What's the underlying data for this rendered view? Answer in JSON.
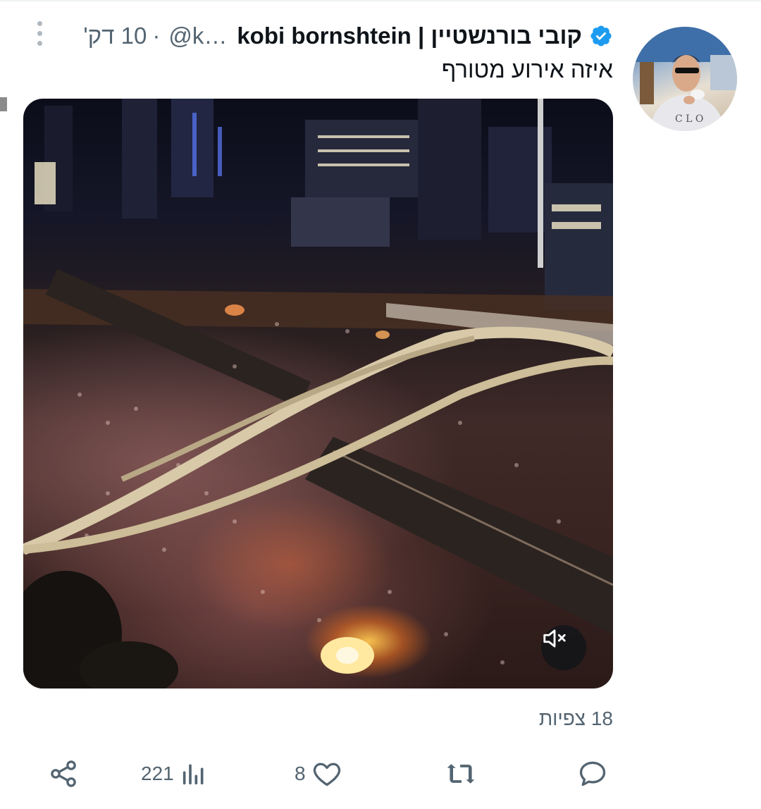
{
  "post": {
    "display_name": "קובי בורנשטיין | kobi bornshtein",
    "handle": "@k…",
    "separator": "·",
    "time": "10 דק'",
    "text": "איזה אירוע מטורף",
    "views": "18 צפיות"
  },
  "media": {
    "mute_icon": "speaker-muted-icon"
  },
  "actions": {
    "reply_count": "",
    "repost_count": "",
    "like_count": "8",
    "view_count": "221"
  },
  "colors": {
    "text": "#0f1419",
    "secondary": "#536471",
    "verified": "#1d9bf0"
  }
}
